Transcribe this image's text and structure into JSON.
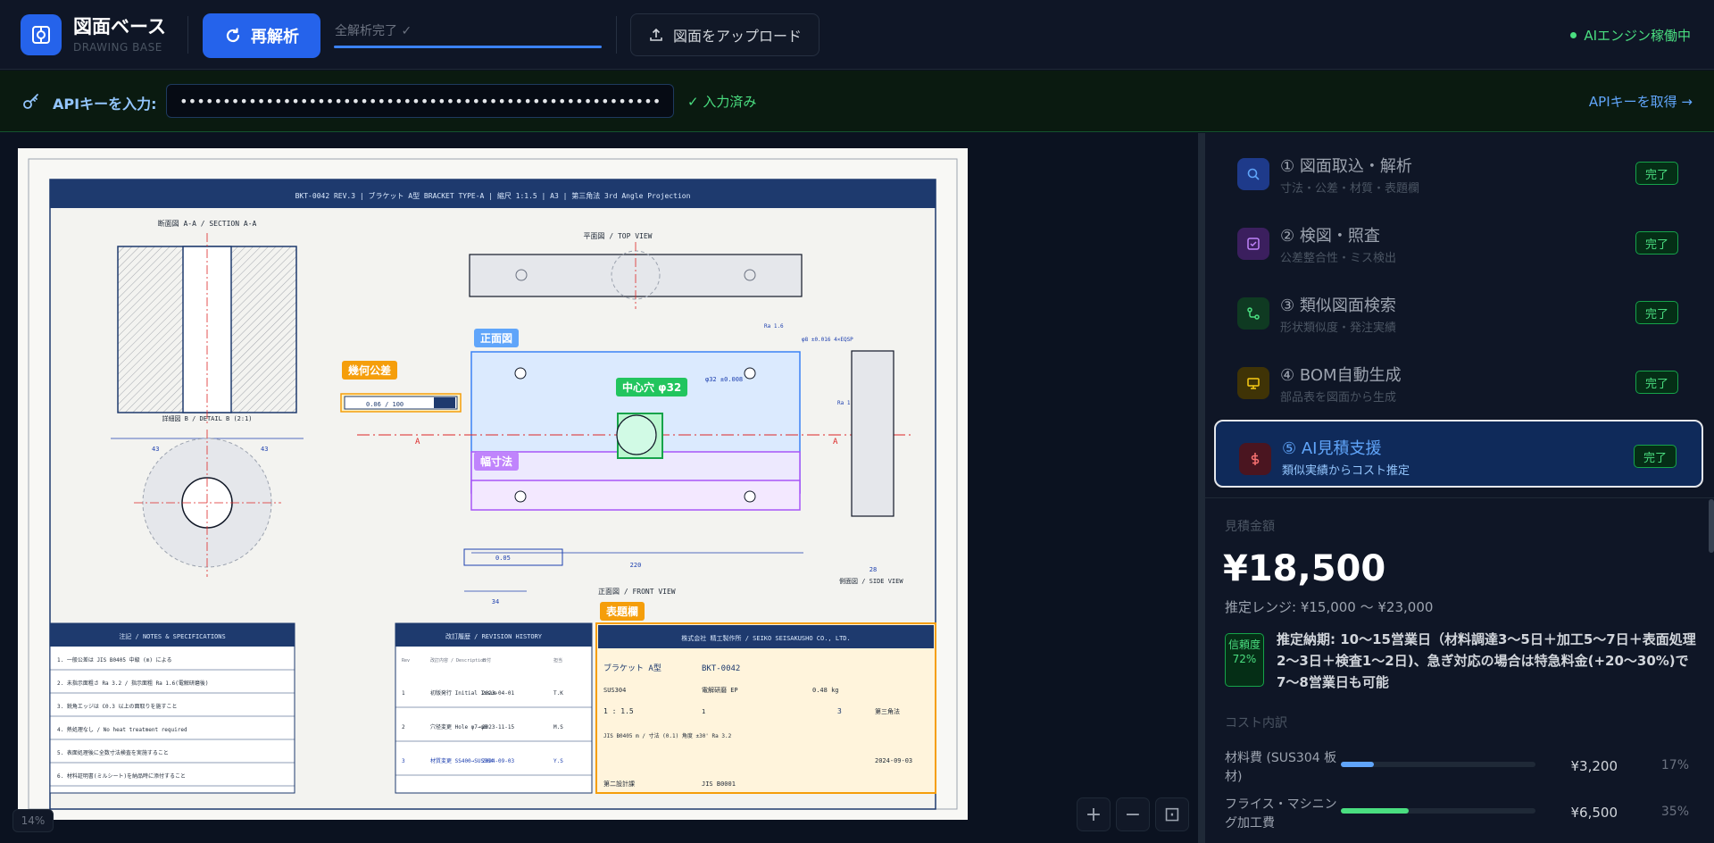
{
  "app": {
    "title": "図面ベース",
    "subtitle": "DRAWING BASE"
  },
  "toolbar": {
    "reanalyze_label": "再解析",
    "progress_label": "全解析完了 ✓",
    "progress_fraction": 1.0,
    "upload_label": "図面をアップロード",
    "status_label": "AIエンジン稼働中"
  },
  "api": {
    "label": "APIキーを入力:",
    "value": "••••••••••••••••••••••••••••••••••••••••••••••••••••••••••",
    "status": "✓ 入力済み",
    "link": "APIキーを取得 →"
  },
  "drawing": {
    "title_bar": "BKT-0042  REV.3  |  ブラケット A型  BRACKET TYPE-A  |  縮尺 1:1.5  |  A3  |  第三角法  3rd Angle Projection",
    "section_view": "断面図 A-A  /  SECTION A-A",
    "top_view": "平面図  /  TOP VIEW",
    "front_view": "正面図  /  FRONT VIEW",
    "side_view": "側面図  /  SIDE VIEW",
    "detail_label": "詳細図 B  /  DETAIL B (2:1)",
    "tags": {
      "geometric": "幾何公差",
      "front": "正面図",
      "center_hole": "中心穴 φ32",
      "width": "幅寸法",
      "title_block": "表題欄"
    },
    "dims": {
      "d220": "220",
      "d34": "34",
      "d28": "28",
      "d43a": "43",
      "d43b": "43",
      "tol": "0.05",
      "geo": "0.06 / 100",
      "phi32": "φ32 ±0.008",
      "ra16a": "Ra 1.6",
      "ra16b": "Ra 1.6",
      "phi8": "φ8 ±0.016  4×EQSP",
      "section_a": "A"
    },
    "notes": {
      "title": "注記  /  NOTES & SPECIFICATIONS",
      "items": [
        "1. 一般公差は JIS B0405 中級 (m) による",
        "2. 未指示面粗さ Ra 3.2 / 指示面粗 Ra 1.6(電解研磨後)",
        "3. 鋭角エッジは C0.3 以上の面取りを施すこと",
        "4. 熱処理なし  /  No heat treatment required",
        "5. 表面処理後に全数寸法検査を実施すること",
        "6. 材料証明書(ミルシート)を納品時に添付すること"
      ]
    },
    "revision": {
      "title": "改訂履歴  /  REVISION HISTORY",
      "headers": [
        "Rev",
        "改訂内容 / Description",
        "日付",
        "担当"
      ],
      "rows": [
        [
          "1",
          "初版発行  Initial Issue",
          "2023-04-01",
          "T.K"
        ],
        [
          "2",
          "穴径変更  Hole φ7→φ8",
          "2023-11-15",
          "M.S"
        ],
        [
          "3",
          "材質変更  SS400→SUS304",
          "2024-09-03",
          "Y.S"
        ]
      ]
    },
    "titleblock": {
      "company": "株式会社 精工製作所  /  SEIKO SEISAKUSHO CO., LTD.",
      "part_name": "ブラケット  A型",
      "part_no": "BKT-0042",
      "material": "SUS304",
      "surface": "電解研磨 EP",
      "weight": "0.48 kg",
      "scale": "1 : 1.5",
      "sheet": "1",
      "rev": "3",
      "projection": "第三角法",
      "tolerance": "JIS B0405 m  /  寸法 (0.1)  角度 ±30'  Ra 3.2",
      "date": "2024-09-03",
      "dept": "第二設計課",
      "std": "JIS B0001"
    }
  },
  "zoom": {
    "level": "14%",
    "in": "+",
    "out": "−",
    "fit": "⊡"
  },
  "steps": [
    {
      "title": "① 図面取込・解析",
      "sub": "寸法・公差・材質・表題欄",
      "badge": "完了",
      "color": "#1e3a8a",
      "icon": "search-icon"
    },
    {
      "title": "② 検図・照査",
      "sub": "公差整合性・ミス検出",
      "badge": "完了",
      "color": "#3b1f5e",
      "icon": "check-square-icon"
    },
    {
      "title": "③ 類似図面検索",
      "sub": "形状類似度・発注実績",
      "badge": "完了",
      "color": "#0f3a22",
      "icon": "similarity-icon"
    },
    {
      "title": "④ BOM自動生成",
      "sub": "部品表を図面から生成",
      "badge": "完了",
      "color": "#3f3306",
      "icon": "monitor-icon"
    },
    {
      "title": "⑤ AI見積支援",
      "sub": "類似実績からコスト推定",
      "badge": "完了",
      "color": "#4a1520",
      "icon": "dollar-icon"
    }
  ],
  "estimate": {
    "label": "見積金額",
    "amount": "¥18,500",
    "range": "推定レンジ: ¥15,000 〜 ¥23,000",
    "confidence": "信頼度 72%",
    "note_head": "推定納期: 10〜15営業日（材料調達3〜5日＋加工5〜7日＋表面処理2〜3日＋検査1〜2日)、急ぎ対応の場合は特急料金(+20〜30%)で7〜8営業日も可能",
    "cost_label": "コスト内訳",
    "costs": [
      {
        "name": "材料費 (SUS304 板材)",
        "value": "¥3,200",
        "pct": "17%",
        "fraction": 0.17,
        "color": "#60a5fa"
      },
      {
        "name": "フライス・マシニング加工費",
        "value": "¥6,500",
        "pct": "35%",
        "fraction": 0.35,
        "color": "#4ade80"
      }
    ]
  }
}
